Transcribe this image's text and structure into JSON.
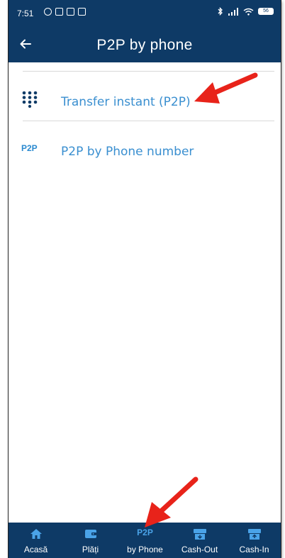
{
  "status_bar": {
    "time": "7:51",
    "battery": "56"
  },
  "app_bar": {
    "title": "P2P by phone",
    "back_icon": "arrow-left-icon"
  },
  "menu": {
    "items": [
      {
        "icon": "keypad-icon",
        "label": "Transfer instant (P2P)"
      },
      {
        "icon": "p2p-badge-icon",
        "icon_text": "P2P",
        "label": "P2P by Phone number"
      }
    ]
  },
  "bottom_nav": {
    "items": [
      {
        "icon": "home-icon",
        "label": "Acasă"
      },
      {
        "icon": "wallet-icon",
        "label": "Plăți"
      },
      {
        "icon": "p2p-badge-icon",
        "icon_text": "P2P",
        "label": "by Phone"
      },
      {
        "icon": "cash-out-icon",
        "label": "Cash-Out"
      },
      {
        "icon": "cash-in-icon",
        "label": "Cash-In"
      }
    ]
  },
  "colors": {
    "header_bg": "#0e3a66",
    "accent_text": "#3a8fd0",
    "annotation_arrow": "#e8231a"
  }
}
